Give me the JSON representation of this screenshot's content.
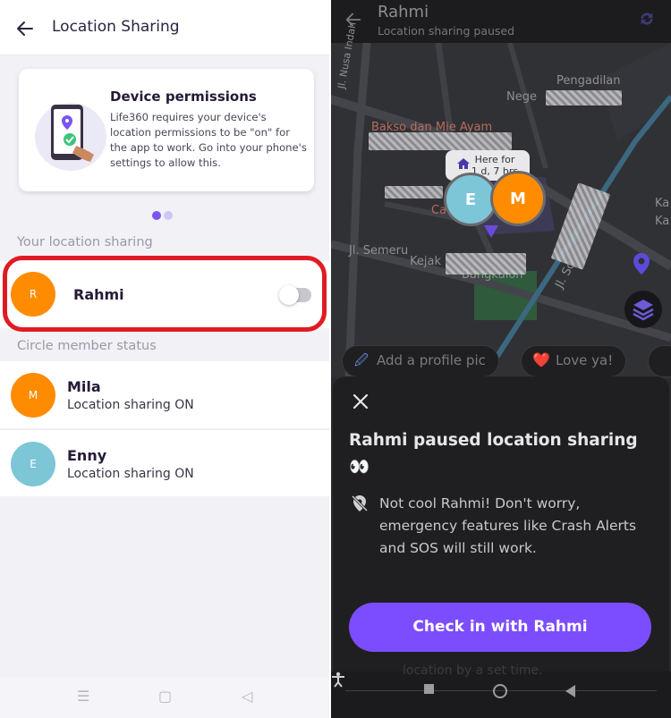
{
  "left": {
    "header": {
      "title": "Location Sharing"
    },
    "permission_card": {
      "title": "Device permissions",
      "body": "Life360 requires your device's location permissions to be \"on\" for the app to work. Go into your phone's settings to allow this."
    },
    "your_sharing_label": "Your location sharing",
    "self": {
      "avatar_letter": "R",
      "avatar_color": "#ff8c00",
      "name": "Rahmi",
      "toggle_on": false
    },
    "circle_label": "Circle member status",
    "members": [
      {
        "avatar_letter": "M",
        "avatar_color": "#ff8c00",
        "name": "Mila",
        "status": "Location sharing ON"
      },
      {
        "avatar_letter": "E",
        "avatar_color": "#7cc6d8",
        "name": "Enny",
        "status": "Location sharing ON"
      }
    ],
    "nav": {
      "menu": "☰",
      "home": "▢",
      "back": "◁"
    }
  },
  "right": {
    "header": {
      "name": "Rahmi",
      "subtitle": "Location sharing paused"
    },
    "map": {
      "labels": [
        "Jl. Nusa Indah",
        "Nege",
        "Pengadilan",
        "Bakso dan Mie Ayam",
        "Here for",
        "1 d, 7 hrs",
        "Ca",
        "Jl. Semeru",
        "Kejak",
        "Bangkulon",
        "Jl. Sc",
        "Ka",
        "Ka"
      ],
      "pin_e": "E",
      "pin_m": "M"
    },
    "pills": [
      {
        "icon": "🖉",
        "label": "Add a profile pic"
      },
      {
        "icon": "❤️",
        "label": "Love ya!"
      }
    ],
    "sheet": {
      "title": "Rahmi paused location sharing 👀",
      "message": "Not cool Rahmi! Don't worry, emergency features like Crash Alerts and SOS will still work.",
      "cta": "Check in with Rahmi"
    },
    "behind_text": "location by a set time.",
    "accent": "#7c4dff"
  }
}
